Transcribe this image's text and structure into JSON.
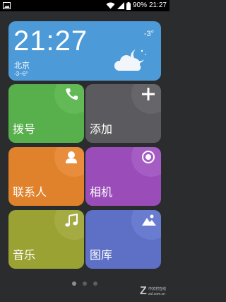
{
  "status_bar": {
    "battery_percent": "90%",
    "time": "21:27",
    "icons": [
      "image-notification-icon",
      "wifi-icon",
      "signal-icon",
      "battery-icon"
    ]
  },
  "weather": {
    "time": "21:27",
    "city": "北京",
    "range": "-3~6°",
    "temperature": "-3°",
    "icon": "moon-cloud-icon"
  },
  "tiles": [
    {
      "label": "拨号",
      "icon": "phone-icon",
      "color": "#58b04c"
    },
    {
      "label": "添加",
      "icon": "plus-icon",
      "color": "#5b5b5f"
    },
    {
      "label": "联系人",
      "icon": "contact-icon",
      "color": "#e0812b"
    },
    {
      "label": "相机",
      "icon": "camera-icon",
      "color": "#9a4db8"
    },
    {
      "label": "音乐",
      "icon": "music-note-icon",
      "color": "#9aa234"
    },
    {
      "label": "图库",
      "icon": "gallery-icon",
      "color": "#5e70c6"
    }
  ],
  "page_indicator": {
    "pages": 3,
    "active": 1
  },
  "watermark": {
    "brand": "Z",
    "line1": "中关村在线",
    "line2": "zol.com.cn"
  }
}
